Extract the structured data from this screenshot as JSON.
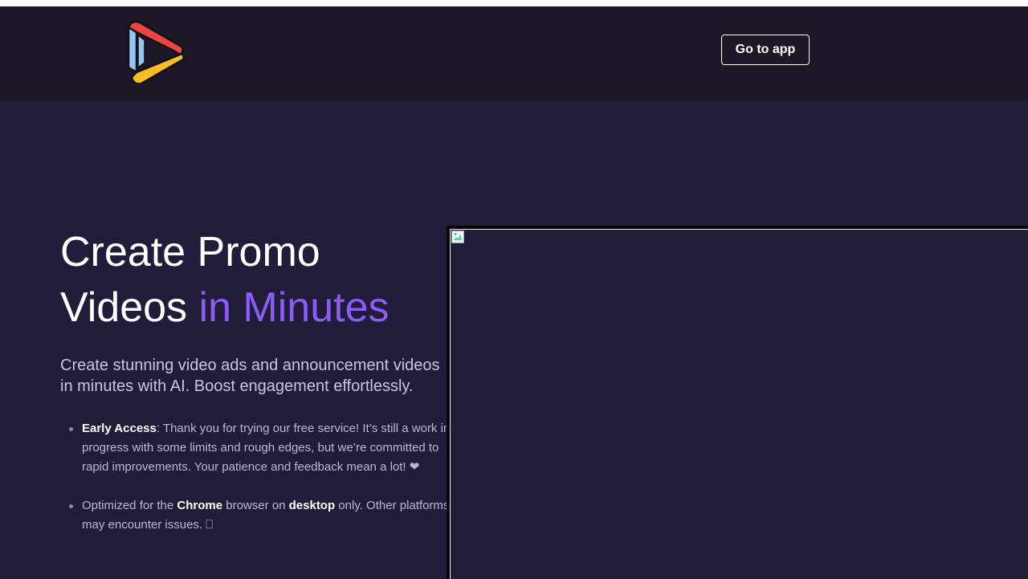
{
  "header": {
    "go_to_app_label": "Go to app"
  },
  "hero": {
    "title_line1": "Create Promo",
    "title_line2_plain": "Videos ",
    "title_line2_accent": "in Minutes",
    "subtitle": "Create stunning video ads and announcement videos in minutes with AI. Boost engagement effortlessly."
  },
  "notes": {
    "early_access_label": "Early Access",
    "early_access_text": ": Thank you for trying our free service! It’s still a work in progress with some limits and rough edges, but we’re committed to rapid improvements. Your patience and feedback mean a lot! ❤",
    "optimized_prefix": "Optimized for the ",
    "optimized_browser": "Chrome",
    "optimized_mid": " browser on ",
    "optimized_device": "desktop",
    "optimized_suffix": " only. Other platforms may encounter issues. ",
    "optimized_glyph": "⎕"
  },
  "icons": {
    "logo": "play-logo-icon",
    "broken_image": "broken-image-icon"
  },
  "colors": {
    "header_bg": "#1e1727",
    "page_bg": "#221c3b",
    "accent": "#8b5cf6",
    "logo_red": "#ef4444",
    "logo_yellow": "#fbbf24",
    "logo_blue": "#93c5fd"
  }
}
